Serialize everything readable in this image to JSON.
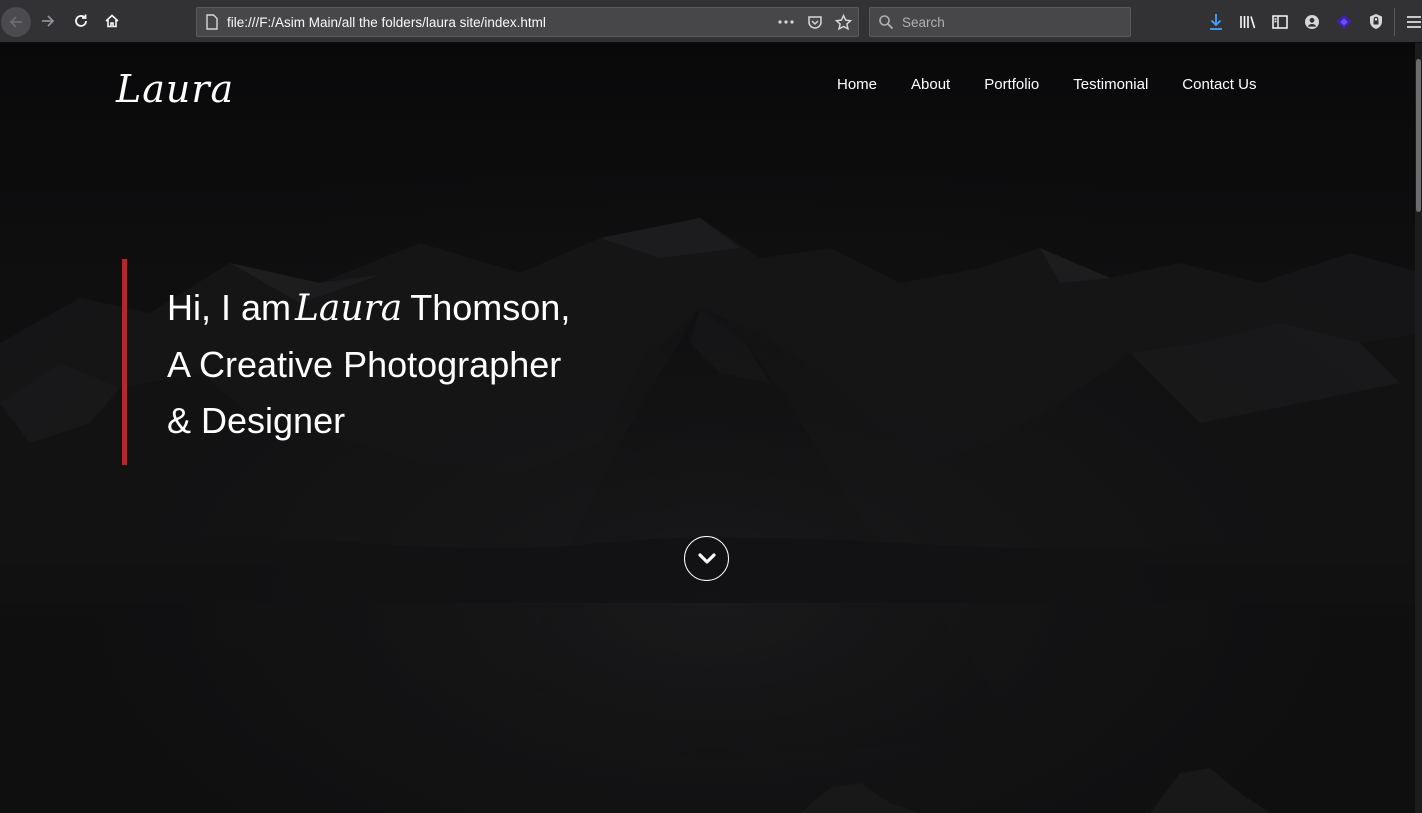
{
  "browser": {
    "url": "file:///F:/Asim Main/all the folders/laura site/index.html",
    "search_placeholder": "Search"
  },
  "site": {
    "logo": "Laura",
    "nav": [
      "Home",
      "About",
      "Portfolio",
      "Testimonial",
      "Contact Us"
    ],
    "hero": {
      "line1_prefix": "Hi, I am",
      "line1_script": "Laura",
      "line1_suffix": "Thomson,",
      "line2": "A Creative Photographer",
      "line3": "& Designer"
    }
  },
  "colors": {
    "accent": "#b4272b",
    "chrome": "#323234",
    "download_icon": "#45a1ff"
  },
  "icons": [
    "back-icon",
    "forward-icon",
    "reload-icon",
    "home-icon",
    "page-icon",
    "more-icon",
    "pocket-icon",
    "bookmark-star-icon",
    "search-icon",
    "download-icon",
    "library-icon",
    "sidebar-icon",
    "account-icon",
    "extension-icon",
    "shield-icon",
    "menu-icon",
    "chevron-down-icon"
  ]
}
